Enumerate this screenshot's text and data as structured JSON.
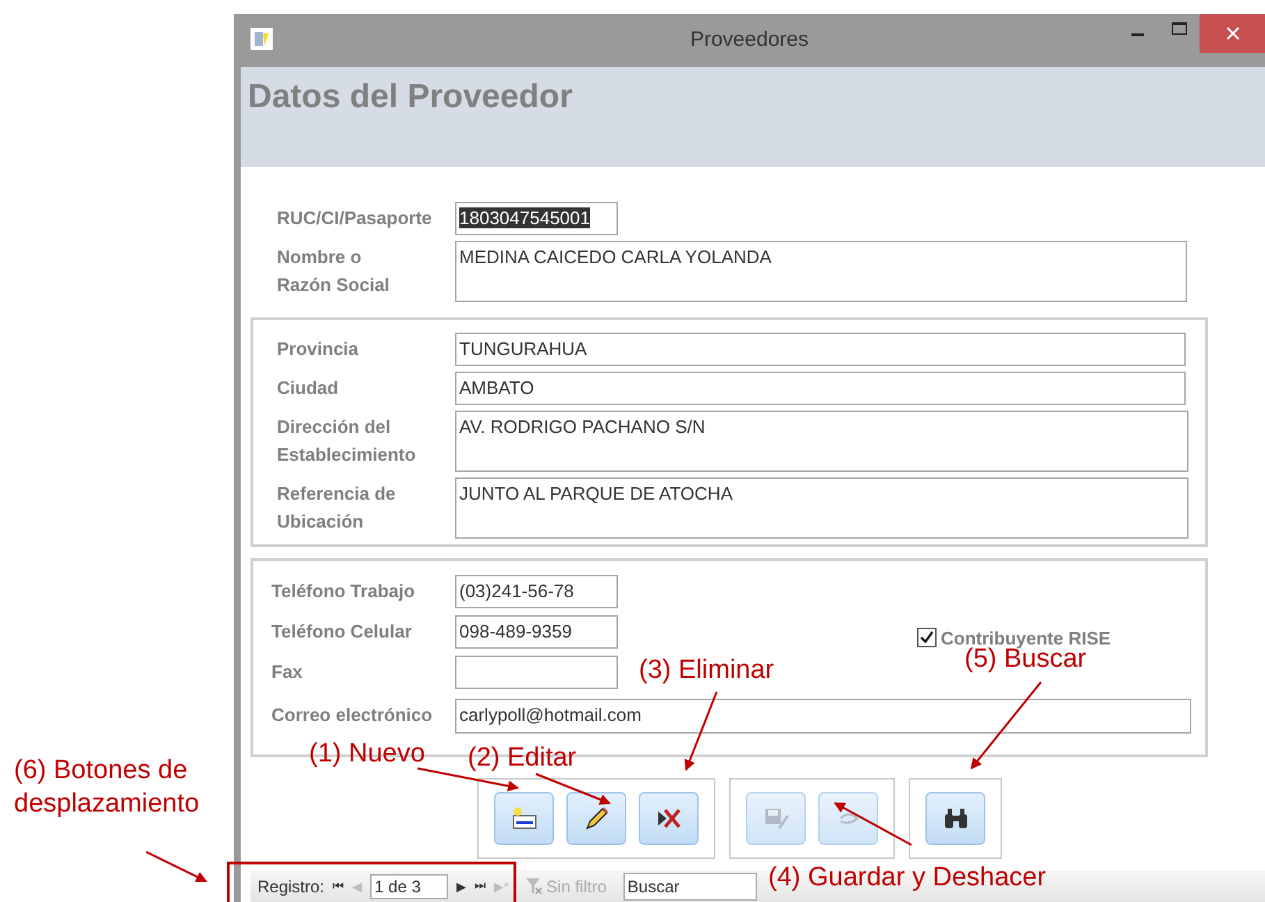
{
  "window": {
    "title": "Proveedores"
  },
  "header": {
    "title": "Datos del Proveedor"
  },
  "identity": [
    {
      "label": "RUC/CI/Pasaporte",
      "value": "1803047545001",
      "kind": "short",
      "selected": true
    },
    {
      "label": "Nombre o Razón Social",
      "value": "MEDINA CAICEDO CARLA YOLANDA",
      "kind": "tall",
      "selected": false
    }
  ],
  "location": [
    {
      "label": "Provincia",
      "value": "TUNGURAHUA",
      "kind": "long"
    },
    {
      "label": "Ciudad",
      "value": "AMBATO",
      "kind": "long"
    },
    {
      "label": "Dirección del Establecimiento",
      "value": "AV. RODRIGO PACHANO S/N",
      "kind": "tall"
    },
    {
      "label": "Referencia de Ubicación",
      "value": "JUNTO AL PARQUE DE ATOCHA",
      "kind": "tall"
    }
  ],
  "contact": [
    {
      "label": "Teléfono Trabajo",
      "value": "(03)241-56-78",
      "kind": "short"
    },
    {
      "label": "Teléfono Celular",
      "value": "098-489-9359",
      "kind": "short"
    },
    {
      "label": "Fax",
      "kind": "short"
    },
    {
      "label": "Correo electrónico",
      "value": "carlypoll@hotmail.com",
      "kind": "wide"
    }
  ],
  "checkbox": {
    "label": "Contribuyente RISE",
    "checked": true
  },
  "button_groups": [
    [
      {
        "kind": "new",
        "disabled": false
      },
      {
        "kind": "edit",
        "disabled": false
      },
      {
        "kind": "delete",
        "disabled": false
      }
    ],
    [
      {
        "kind": "save",
        "disabled": true
      },
      {
        "kind": "undo",
        "disabled": true
      }
    ],
    [
      {
        "kind": "find",
        "disabled": false
      }
    ]
  ],
  "navigation": {
    "label": "Registro:",
    "first": "⏮",
    "previous": "◀",
    "record": "1 de 3",
    "next": "▶",
    "last": "⏭",
    "new": "▶*",
    "filter": "Sin filtro",
    "search_placeholder": "Buscar"
  },
  "annotations": [
    {
      "text": "(6) Botones de desplazamiento"
    },
    {
      "text": "(1) Nuevo"
    },
    {
      "text": "(2) Editar"
    },
    {
      "text": "(3) Eliminar"
    },
    {
      "text": "(5) Buscar"
    },
    {
      "text": "(4) Guardar y Deshacer"
    }
  ]
}
